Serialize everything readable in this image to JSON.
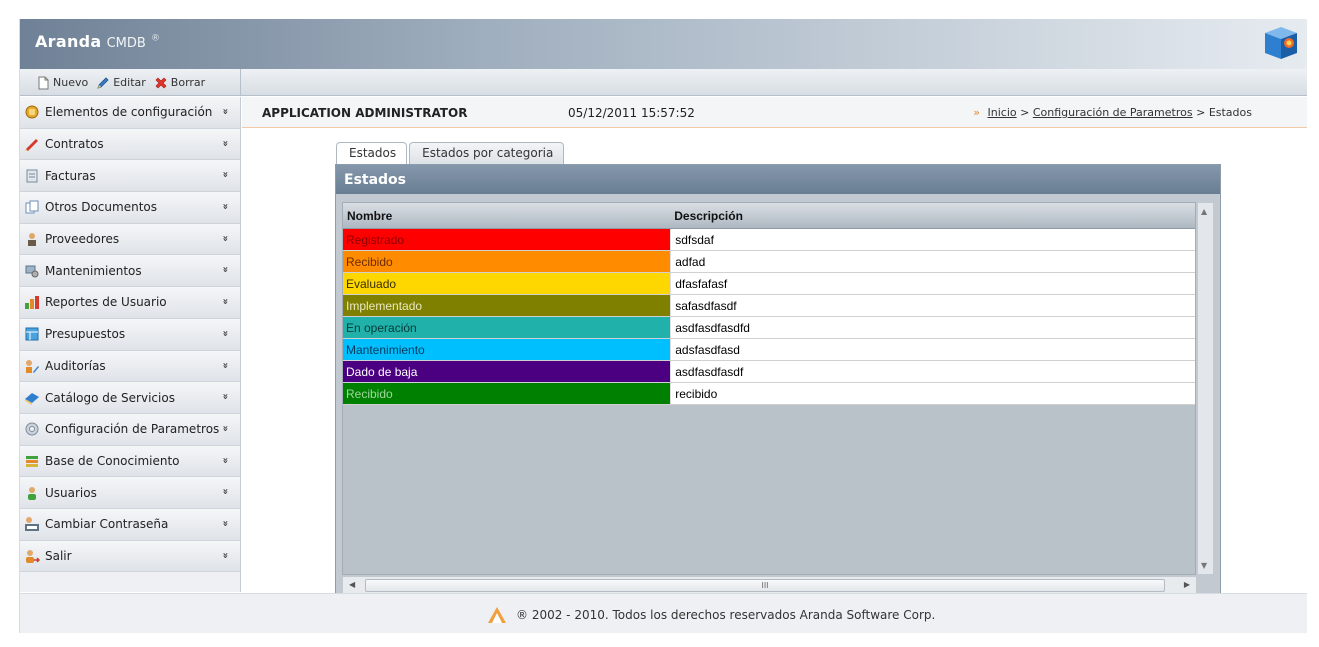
{
  "header": {
    "brand": "Aranda",
    "product": "CMDB",
    "reg": "®"
  },
  "toolbar": {
    "new_label": "Nuevo",
    "edit_label": "Editar",
    "delete_label": "Borrar"
  },
  "sidebar": {
    "items": [
      {
        "label": "Elementos de configuración",
        "icon": "config-elements-icon"
      },
      {
        "label": "Contratos",
        "icon": "contract-icon"
      },
      {
        "label": "Facturas",
        "icon": "invoice-icon"
      },
      {
        "label": "Otros Documentos",
        "icon": "documents-icon"
      },
      {
        "label": "Proveedores",
        "icon": "providers-icon"
      },
      {
        "label": "Mantenimientos",
        "icon": "maintenance-icon"
      },
      {
        "label": "Reportes de Usuario",
        "icon": "reports-icon"
      },
      {
        "label": "Presupuestos",
        "icon": "budget-icon"
      },
      {
        "label": "Auditorías",
        "icon": "audit-icon"
      },
      {
        "label": "Catálogo de Servicios",
        "icon": "catalog-icon"
      },
      {
        "label": "Configuración de Parametros",
        "icon": "settings-gear-icon"
      },
      {
        "label": "Base de Conocimiento",
        "icon": "knowledge-base-icon"
      },
      {
        "label": "Usuarios",
        "icon": "users-icon"
      },
      {
        "label": "Cambiar Contraseña",
        "icon": "password-icon"
      },
      {
        "label": "Salir",
        "icon": "logout-icon"
      }
    ],
    "chevron": "»"
  },
  "infobar": {
    "user": "APPLICATION ADMINISTRATOR",
    "datetime": "05/12/2011 15:57:52",
    "breadcrumb_arrow": "»",
    "crumb_home": "Inicio",
    "crumb_sep": ">",
    "crumb_config": "Configuración de Parametros",
    "crumb_current": "Estados"
  },
  "tabs": [
    {
      "label": "Estados",
      "active": true
    },
    {
      "label": "Estados por categoria",
      "active": false
    }
  ],
  "panel": {
    "title": "Estados",
    "columns": [
      "Nombre",
      "Descripción"
    ],
    "rows": [
      {
        "nombre": "Registrado",
        "descripcion": "sdfsdaf",
        "bg": "#ff0000",
        "fg": "#8b0000"
      },
      {
        "nombre": "Recibido",
        "descripcion": "adfad",
        "bg": "#ff8c00",
        "fg": "#6b2a00"
      },
      {
        "nombre": "Evaluado",
        "descripcion": "dfasfafasf",
        "bg": "#ffd700",
        "fg": "#3a2e00"
      },
      {
        "nombre": "Implementado",
        "descripcion": "safasdfasdf",
        "bg": "#808000",
        "fg": "#e8e8c0"
      },
      {
        "nombre": "En operación",
        "descripcion": "asdfasdfasdfd",
        "bg": "#20b2aa",
        "fg": "#053a37"
      },
      {
        "nombre": "Mantenimiento",
        "descripcion": "adsfasdfasd",
        "bg": "#00bfff",
        "fg": "#003a5a"
      },
      {
        "nombre": "Dado de baja",
        "descripcion": "asdfasdfasdf",
        "bg": "#4b0082",
        "fg": "#ffffff"
      },
      {
        "nombre": "Recibido",
        "descripcion": "recibido",
        "bg": "#008000",
        "fg": "#9fd79f"
      }
    ]
  },
  "scrollbar": {
    "grip": "III"
  },
  "footer": {
    "text": "® 2002 - 2010. Todos los derechos reservados Aranda Software Corp."
  }
}
